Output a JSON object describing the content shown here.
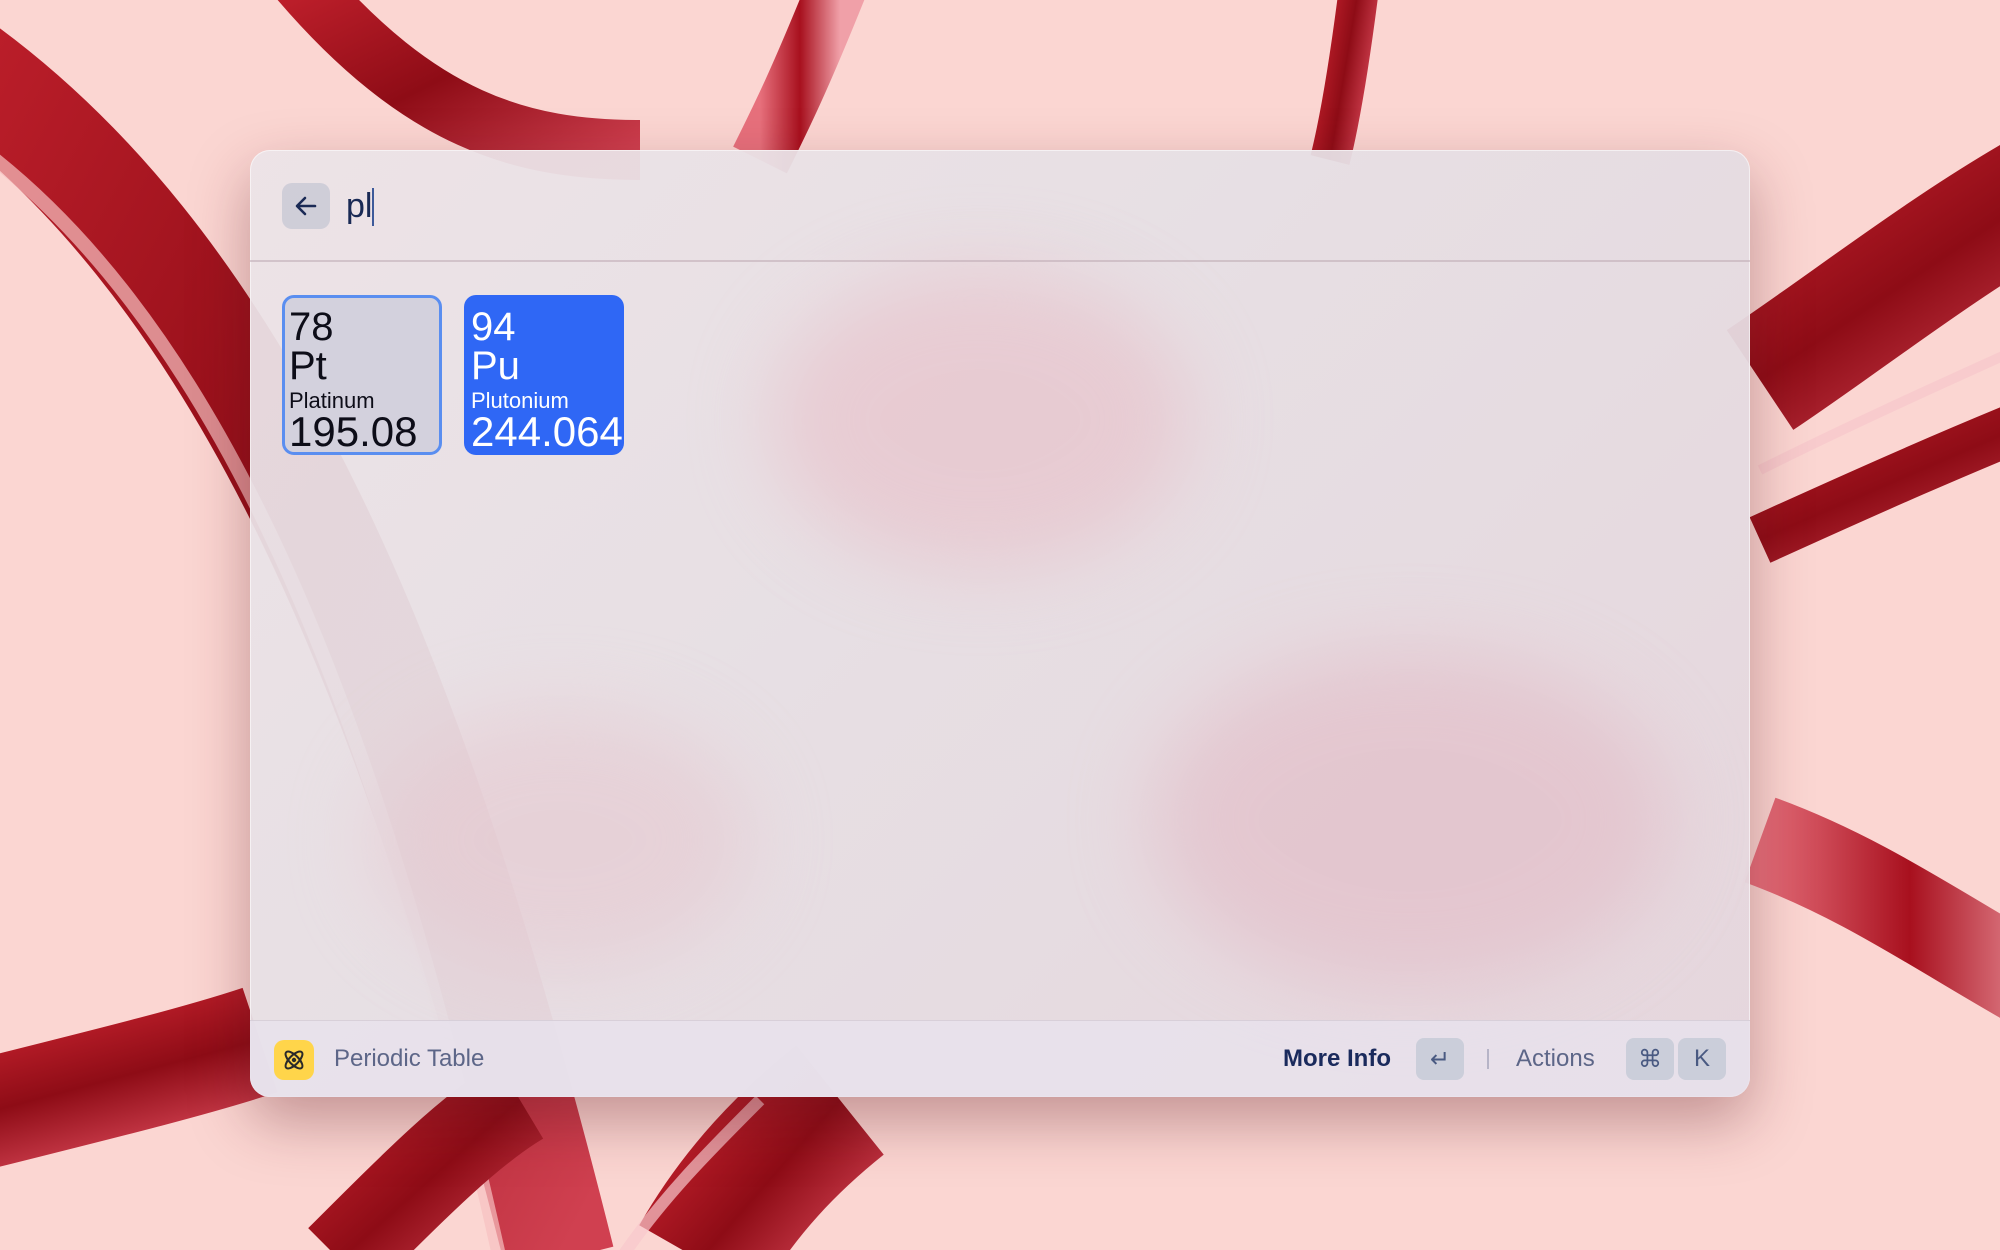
{
  "search": {
    "query": "pl",
    "back_icon": "arrow-left-icon"
  },
  "results": [
    {
      "number": "78",
      "symbol": "Pt",
      "name": "Platinum",
      "mass": "195.08",
      "state": "focused",
      "color": "#d3d1dd"
    },
    {
      "number": "94",
      "symbol": "Pu",
      "name": "Plutonium",
      "mass": "244.064",
      "state": "selected",
      "color": "#2f67f5"
    }
  ],
  "footer": {
    "extension_icon": "atom-icon",
    "extension_name": "Periodic Table",
    "primary_action": "More Info",
    "primary_shortcut": "↵",
    "actions_label": "Actions",
    "actions_shortcut_mod": "⌘",
    "actions_shortcut_key": "K"
  },
  "colors": {
    "accent": "#2f67f5",
    "focus_border": "#5a8ef0",
    "extension_icon_bg": "#ffd54a",
    "wallpaper_ribbon": "#a8101e"
  }
}
